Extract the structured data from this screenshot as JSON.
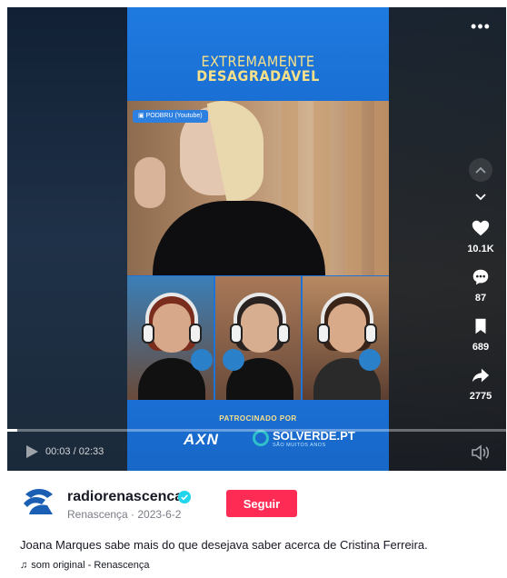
{
  "video": {
    "show_title_line1": "EXTREMAMENTE",
    "show_title_line2": "DESAGRADÁVEL",
    "source_badge": "PODBRU (Youtube)",
    "sponsor_label": "PATROCINADO POR",
    "sponsor_logo_1": "AXN",
    "sponsor_logo_2": "SOLVERDE.PT",
    "sponsor_logo_2_sub": "SÃO MUITOS ANOS",
    "current_time": "00:03",
    "duration": "02:33",
    "progress": 0.0196,
    "more_label": "•••"
  },
  "actions": {
    "likes": "10.1K",
    "comments": "87",
    "saves": "689",
    "shares": "2775"
  },
  "channel": {
    "name": "radiorenascenca",
    "meta": "Renascença · 2023-6-2",
    "follow_label": "Seguir"
  },
  "post": {
    "caption": "Joana Marques sabe mais do que desejava saber acerca de Cristina Ferreira.",
    "sound": "som original - Renascença"
  },
  "colors": {
    "follow": "#fe2c55",
    "verified": "#20d5ec",
    "frame_blue": "#1c73d8",
    "title_yellow": "#f7e08a"
  }
}
